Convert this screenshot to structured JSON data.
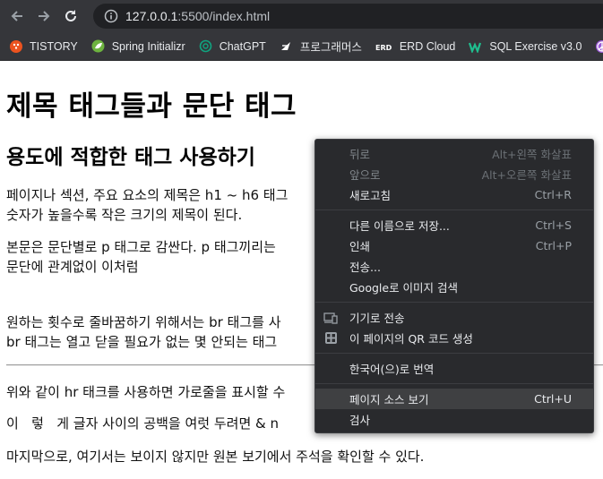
{
  "browser": {
    "url_host": "127.0.0.1",
    "url_rest": ":5500/index.html",
    "bookmarks": [
      {
        "label": "TISTORY",
        "icon": "tistory-icon",
        "color": "#eb531f"
      },
      {
        "label": "Spring Initializr",
        "icon": "spring-leaf-icon",
        "color": "#6db33f"
      },
      {
        "label": "ChatGPT",
        "icon": "chatgpt-icon",
        "color": "#10a37f"
      },
      {
        "label": "프로그래머스",
        "icon": "programmers-icon",
        "color": "#ffffff"
      },
      {
        "label": "ERD Cloud",
        "icon": "erd-cloud-icon",
        "color": "#ffffff"
      },
      {
        "label": "SQL Exercise v3.0",
        "icon": "sql-exercise-icon",
        "color": "#1fbf8f"
      }
    ]
  },
  "content": {
    "h1": "제목 태그들과 문단 태그",
    "h2": "용도에 적합한 태그 사용하기",
    "paragraphs": [
      "페이지나 섹션, 주요 요소의 제목은 h1 ~ h6 태그",
      "숫자가 높을수록 작은 크기의 제목이 된다.",
      "본문은 문단별로 p 태그로 감싼다. p 태그끼리는",
      "문단에 관계없이 이처럼",
      "원하는 횟수로 줄바꿈하기 위해서는 br 태그를 사",
      "br 태그는 열고 닫을 필요가 없는 몇 안되는 태그",
      "위와 같이 hr 태크를 사용하면 가로줄을 표시할 수",
      "이   렇   게 글자 사이의 공백을 여럿 두려면 & n",
      "마지막으로, 여기서는 보이지 않지만 원본 보기에서 주석을 확인할 수 있다."
    ]
  },
  "context_menu": {
    "items": [
      {
        "label": "뒤로",
        "shortcut": "Alt+왼쪽 화살표",
        "disabled": true
      },
      {
        "label": "앞으로",
        "shortcut": "Alt+오른쪽 화살표",
        "disabled": true
      },
      {
        "label": "새로고침",
        "shortcut": "Ctrl+R"
      },
      {
        "label": "다른 이름으로 저장...",
        "shortcut": "Ctrl+S"
      },
      {
        "label": "인쇄",
        "shortcut": "Ctrl+P"
      },
      {
        "label": "전송...",
        "shortcut": ""
      },
      {
        "label": "Google로 이미지 검색",
        "shortcut": ""
      },
      {
        "label": "기기로 전송",
        "shortcut": "",
        "icon": "send-to-device-icon"
      },
      {
        "label": "이 페이지의 QR 코드 생성",
        "shortcut": "",
        "icon": "qr-code-icon"
      },
      {
        "label": "한국어(으)로 번역",
        "shortcut": ""
      },
      {
        "label": "페이지 소스 보기",
        "shortcut": "Ctrl+U",
        "hovered": true
      },
      {
        "label": "검사",
        "shortcut": ""
      }
    ]
  },
  "colors": {
    "chrome_dark": "#35363a",
    "omnibox": "#202124",
    "menu_bg": "#292a2d",
    "menu_hover": "#3f4042"
  }
}
